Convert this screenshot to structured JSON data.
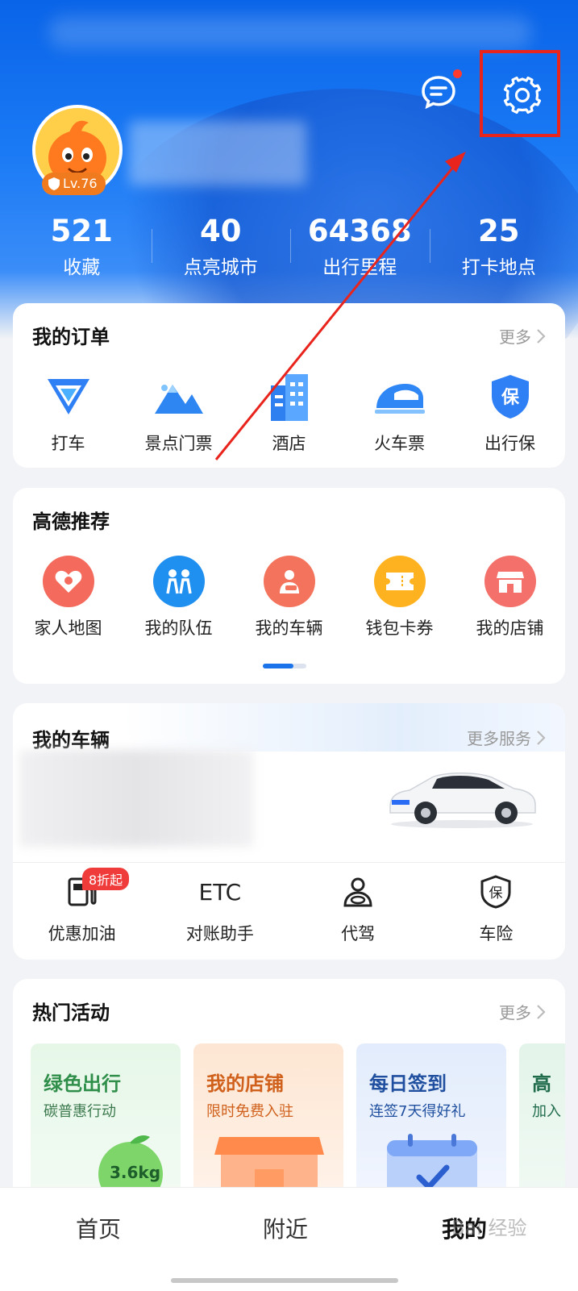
{
  "header": {
    "level": "Lv.76",
    "stats": [
      {
        "value": "521",
        "label": "收藏"
      },
      {
        "value": "40",
        "label": "点亮城市"
      },
      {
        "value": "64368",
        "label": "出行里程"
      },
      {
        "value": "25",
        "label": "打卡地点"
      }
    ]
  },
  "orders": {
    "title": "我的订单",
    "more": "更多",
    "items": [
      {
        "label": "打车",
        "icon": "taxi-icon"
      },
      {
        "label": "景点门票",
        "icon": "mountain-icon"
      },
      {
        "label": "酒店",
        "icon": "hotel-icon"
      },
      {
        "label": "火车票",
        "icon": "train-icon"
      },
      {
        "label": "出行保",
        "icon": "insurance-shield-icon"
      }
    ]
  },
  "recommend": {
    "title": "高德推荐",
    "items": [
      {
        "label": "家人地图",
        "icon": "family-heart-icon"
      },
      {
        "label": "我的队伍",
        "icon": "team-icon"
      },
      {
        "label": "我的车辆",
        "icon": "vehicle-person-icon"
      },
      {
        "label": "钱包卡券",
        "icon": "ticket-icon"
      },
      {
        "label": "我的店铺",
        "icon": "store-icon"
      }
    ]
  },
  "vehicle": {
    "title": "我的车辆",
    "more": "更多服务",
    "services": [
      {
        "label": "优惠加油",
        "icon": "fuel-icon",
        "badge": "8折起"
      },
      {
        "label": "对账助手",
        "icon_text": "ETC"
      },
      {
        "label": "代驾",
        "icon": "driver-icon"
      },
      {
        "label": "车险",
        "icon_text": "保"
      }
    ]
  },
  "activities": {
    "title": "热门活动",
    "more": "更多",
    "items": [
      {
        "title": "绿色出行",
        "subtitle": "碳普惠行动",
        "extra": "3.6kg",
        "color": "#2f8f4a",
        "bg": "#e3f6e6"
      },
      {
        "title": "我的店铺",
        "subtitle": "限时免费入驻",
        "color": "#d0611d",
        "bg": "#fdebdc"
      },
      {
        "title": "每日签到",
        "subtitle": "连签7天得好礼",
        "color": "#1f4f9e",
        "bg": "#e3ecfb"
      },
      {
        "title": "高",
        "subtitle": "加入",
        "color": "#1f6b4a",
        "bg": "#e4f4ec"
      }
    ]
  },
  "tabbar": {
    "home": "首页",
    "nearby": "附近",
    "mine": "我的"
  },
  "watermark": "Bai 经验",
  "colors": {
    "brand_blue": "#1a73e8",
    "highlight_red": "#e8241d"
  }
}
